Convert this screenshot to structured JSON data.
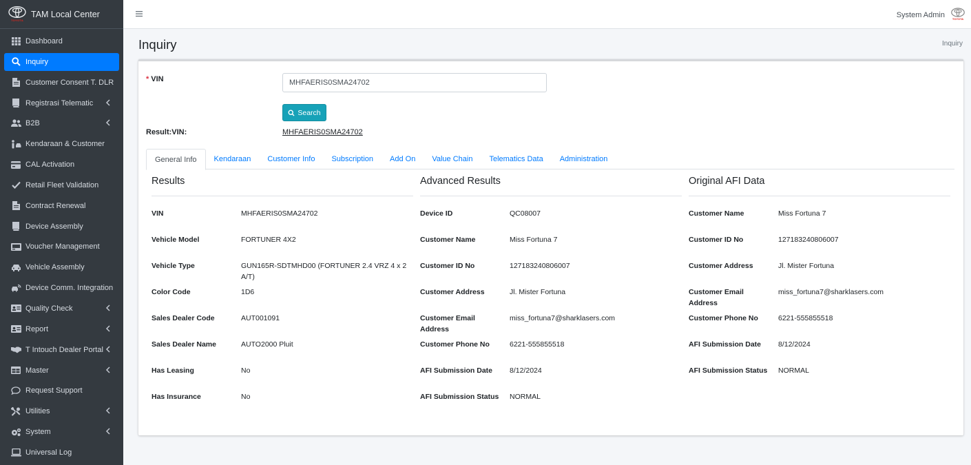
{
  "brand": {
    "name": "TAM Local Center",
    "logo_text": "TOYOTA"
  },
  "sidebar": {
    "items": [
      {
        "label": "Dashboard",
        "icon": "grid-icon",
        "has_children": false,
        "active": false
      },
      {
        "label": "Inquiry",
        "icon": "search-icon",
        "has_children": false,
        "active": true
      },
      {
        "label": "Customer Consent T. DLR",
        "icon": "file-icon",
        "has_children": false,
        "active": false
      },
      {
        "label": "Registrasi Telematic",
        "icon": "book-icon",
        "has_children": true,
        "active": false
      },
      {
        "label": "B2B",
        "icon": "users-icon",
        "has_children": true,
        "active": false
      },
      {
        "label": "Kendaraan & Customer",
        "icon": "person-car-icon",
        "has_children": false,
        "active": false
      },
      {
        "label": "CAL Activation",
        "icon": "card-icon",
        "has_children": false,
        "active": false
      },
      {
        "label": "Retail Fleet Validation",
        "icon": "check-icon",
        "has_children": false,
        "active": false
      },
      {
        "label": "Contract Renewal",
        "icon": "file-icon",
        "has_children": false,
        "active": false
      },
      {
        "label": "Device Assembly",
        "icon": "book-icon",
        "has_children": false,
        "active": false
      },
      {
        "label": "Voucher Management",
        "icon": "voucher-icon",
        "has_children": false,
        "active": false
      },
      {
        "label": "Vehicle Assembly",
        "icon": "car-icon",
        "has_children": false,
        "active": false
      },
      {
        "label": "Device Comm. Integration",
        "icon": "car-signal-icon",
        "has_children": false,
        "active": false
      },
      {
        "label": "Quality Check",
        "icon": "id-card-icon",
        "has_children": true,
        "active": false
      },
      {
        "label": "Report",
        "icon": "id-card-icon",
        "has_children": true,
        "active": false
      },
      {
        "label": "T Intouch Dealer Portal",
        "icon": "handshake-icon",
        "has_children": true,
        "active": false
      },
      {
        "label": "Master",
        "icon": "table-icon",
        "has_children": true,
        "active": false
      },
      {
        "label": "Request Support",
        "icon": "chat-icon",
        "has_children": false,
        "active": false
      },
      {
        "label": "Utilities",
        "icon": "tools-icon",
        "has_children": true,
        "active": false
      },
      {
        "label": "System",
        "icon": "gears-icon",
        "has_children": true,
        "active": false
      },
      {
        "label": "Universal Log",
        "icon": "laptop-icon",
        "has_children": false,
        "active": false
      }
    ]
  },
  "topbar": {
    "user": "System Admin",
    "logo_text": "TOYOTA"
  },
  "header": {
    "title": "Inquiry",
    "breadcrumb": "Inquiry"
  },
  "form": {
    "vin_label": "VIN",
    "vin_value": "MHFAERIS0SMA24702",
    "search_label": "Search",
    "result_label": "Result:VIN:",
    "result_value": "MHFAERIS0SMA24702"
  },
  "tabs": [
    {
      "label": "General Info",
      "active": true
    },
    {
      "label": "Kendaraan",
      "active": false
    },
    {
      "label": "Customer Info",
      "active": false
    },
    {
      "label": "Subscription",
      "active": false
    },
    {
      "label": "Add On",
      "active": false
    },
    {
      "label": "Value Chain",
      "active": false
    },
    {
      "label": "Telematics Data",
      "active": false
    },
    {
      "label": "Administration",
      "active": false
    }
  ],
  "sections": [
    {
      "title": "Results",
      "rows": [
        {
          "k": "VIN",
          "v": "MHFAERIS0SMA24702"
        },
        {
          "k": "Vehicle Model",
          "v": "FORTUNER 4X2"
        },
        {
          "k": "Vehicle Type",
          "v": "GUN165R-SDTMHD00 (FORTUNER 2.4 VRZ 4 x 2 A/T)"
        },
        {
          "k": "Color Code",
          "v": "1D6"
        },
        {
          "k": "Sales Dealer Code",
          "v": "AUT001091"
        },
        {
          "k": "Sales Dealer Name",
          "v": "AUTO2000 Pluit"
        },
        {
          "k": "Has Leasing",
          "v": "No"
        },
        {
          "k": "Has Insurance",
          "v": "No"
        }
      ]
    },
    {
      "title": "Advanced Results",
      "rows": [
        {
          "k": "Device ID",
          "v": "QC08007"
        },
        {
          "k": "Customer Name",
          "v": "Miss Fortuna 7"
        },
        {
          "k": "Customer ID No",
          "v": "127183240806007"
        },
        {
          "k": "Customer Address",
          "v": "Jl. Mister Fortuna"
        },
        {
          "k": "Customer Email Address",
          "v": "miss_fortuna7@sharklasers.com"
        },
        {
          "k": "Customer Phone No",
          "v": "6221-555855518"
        },
        {
          "k": "AFI Submission Date",
          "v": "8/12/2024"
        },
        {
          "k": "AFI Submission Status",
          "v": "NORMAL"
        }
      ]
    },
    {
      "title": "Original AFI Data",
      "rows": [
        {
          "k": "Customer Name",
          "v": "Miss Fortuna 7"
        },
        {
          "k": "Customer ID No",
          "v": "127183240806007"
        },
        {
          "k": "Customer Address",
          "v": "Jl. Mister Fortuna"
        },
        {
          "k": "Customer Email Address",
          "v": "miss_fortuna7@sharklasers.com"
        },
        {
          "k": "Customer Phone No",
          "v": "6221-555855518"
        },
        {
          "k": "AFI Submission Date",
          "v": "8/12/2024"
        },
        {
          "k": "AFI Submission Status",
          "v": "NORMAL"
        }
      ]
    }
  ],
  "colors": {
    "sidebar": "#343a40",
    "active": "#007bff",
    "search_button": "#17a2b8",
    "required": "#dc3545",
    "link": "#007bff"
  }
}
